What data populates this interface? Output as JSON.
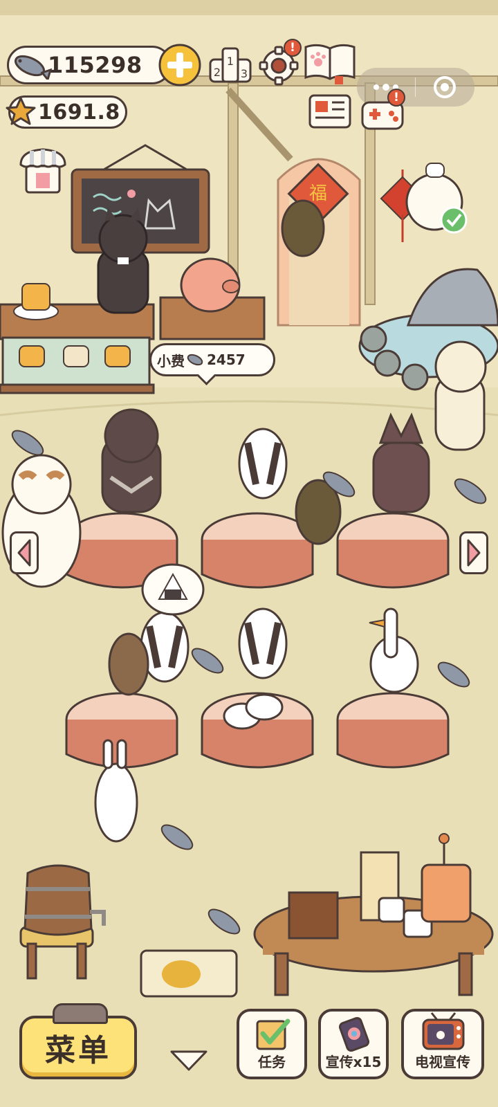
{
  "currency": {
    "fish_amount": "115298",
    "star_amount": "1691.8"
  },
  "tip_bubble": {
    "label": "小费",
    "amount": "2457"
  },
  "bottom_bar": {
    "menu_label": "菜单",
    "tasks_label": "任务",
    "promo_label": "宣传x15",
    "tv_promo_label": "电视宣传"
  },
  "badges": {
    "settings": "!",
    "gamepad": "!"
  },
  "colors": {
    "floor": "#e9dfb7",
    "wall": "#efe4c0",
    "tablecloth_dark": "#d6836a",
    "tablecloth_light": "#f3d1bd",
    "accent_yellow": "#fde27a",
    "alert_red": "#e0593a"
  },
  "icons": {
    "fish": "fish-icon",
    "star": "star-icon",
    "add": "plus-icon",
    "ranking": "ranking-podium-icon",
    "settings": "gear-icon",
    "guidebook": "paw-book-icon",
    "news": "newspaper-icon",
    "gamepad": "gamepad-icon",
    "shop": "shop-awning-icon",
    "more": "more-dots-icon",
    "close": "target-close-icon",
    "arrow_left": "arrow-left-icon",
    "arrow_right": "arrow-right-icon",
    "collapse": "chevron-down-icon",
    "tasks": "checklist-icon",
    "promo": "promo-phone-icon",
    "tv": "tv-icon"
  }
}
